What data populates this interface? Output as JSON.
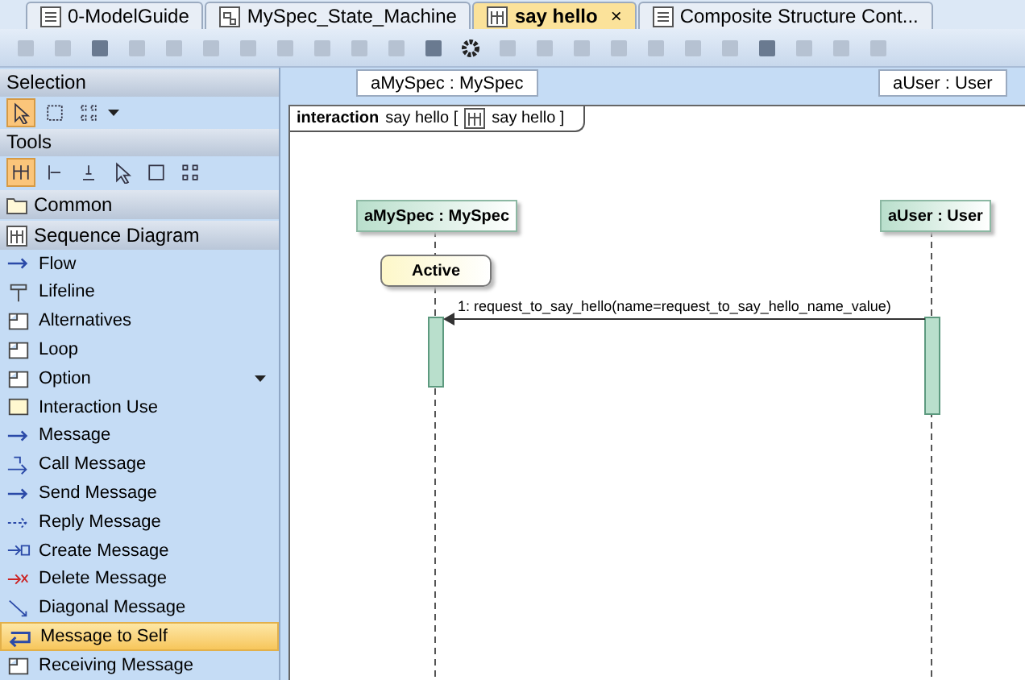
{
  "tabs": [
    {
      "label": "0-ModelGuide",
      "selected": false,
      "kind": "guide"
    },
    {
      "label": "MySpec_State_Machine",
      "selected": false,
      "kind": "state"
    },
    {
      "label": "say hello",
      "selected": true,
      "kind": "sequence",
      "close": "×"
    },
    {
      "label": "Composite Structure Cont...",
      "selected": false,
      "kind": "composite"
    }
  ],
  "lifeline_headers": [
    "aMySpec : MySpec",
    "aUser : User"
  ],
  "palette": {
    "selection": {
      "title": "Selection",
      "tools": [
        {
          "kind": "pointer",
          "selected": true
        },
        {
          "kind": "rect-select",
          "selected": false
        },
        {
          "kind": "grid-select",
          "selected": false
        }
      ]
    },
    "tools": {
      "title": "Tools",
      "tools": [
        {
          "selected": true
        },
        {
          "selected": false
        },
        {
          "selected": false
        },
        {
          "selected": false
        },
        {
          "selected": false
        },
        {
          "selected": false
        }
      ]
    },
    "groups": [
      {
        "label": "Common",
        "kind": "folder"
      },
      {
        "label": "Sequence Diagram",
        "kind": "sequence"
      }
    ],
    "items": [
      {
        "label": "Flow",
        "kind": "arrow",
        "selected": false
      },
      {
        "label": "Lifeline",
        "kind": "lifeline",
        "selected": false
      },
      {
        "label": "Alternatives",
        "kind": "fragment",
        "selected": false
      },
      {
        "label": "Loop",
        "kind": "fragment",
        "selected": false
      },
      {
        "label": "Option",
        "kind": "fragment",
        "selected": false,
        "has_menu": true
      },
      {
        "label": "Interaction Use",
        "kind": "box",
        "selected": false
      },
      {
        "label": "Message",
        "kind": "arrow",
        "selected": false
      },
      {
        "label": "Call Message",
        "kind": "call",
        "selected": false
      },
      {
        "label": "Send Message",
        "kind": "arrow",
        "selected": false
      },
      {
        "label": "Reply Message",
        "kind": "dashed",
        "selected": false
      },
      {
        "label": "Create Message",
        "kind": "create",
        "selected": false
      },
      {
        "label": "Delete Message",
        "kind": "delete",
        "selected": false
      },
      {
        "label": "Diagonal Message",
        "kind": "diagonal",
        "selected": false
      },
      {
        "label": "Message to Self",
        "kind": "self",
        "selected": true
      },
      {
        "label": "Receiving Message",
        "kind": "fragment",
        "selected": false
      }
    ]
  },
  "diagram": {
    "frame": {
      "keyword": "interaction",
      "name": "say hello [",
      "ref": "say hello ]"
    },
    "lifelines": [
      {
        "name": "aMySpec : MySpec"
      },
      {
        "name": "aUser : User"
      }
    ],
    "state_invariant": "Active",
    "message": "1: request_to_say_hello(name=request_to_say_hello_name_value)"
  }
}
